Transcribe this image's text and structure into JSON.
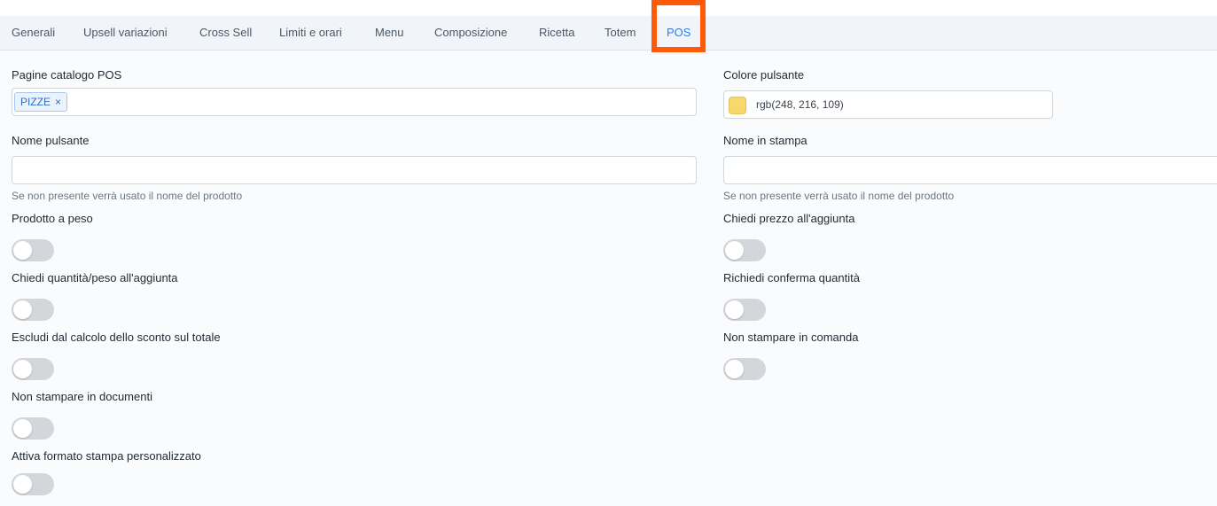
{
  "tabs": [
    {
      "label": "Generali",
      "active": false
    },
    {
      "label": "Upsell variazioni",
      "active": false
    },
    {
      "label": "Cross Sell",
      "active": false
    },
    {
      "label": "Limiti e orari",
      "active": false
    },
    {
      "label": "Menu",
      "active": false
    },
    {
      "label": "Composizione",
      "active": false
    },
    {
      "label": "Ricetta",
      "active": false
    },
    {
      "label": "Totem",
      "active": false
    },
    {
      "label": "POS",
      "active": true
    }
  ],
  "form": {
    "catalog_pages": {
      "label": "Pagine catalogo POS",
      "chips": [
        {
          "label": "PIZZE",
          "remove": "×"
        }
      ]
    },
    "button_color": {
      "label": "Colore pulsante",
      "value": "rgb(248, 216, 109)",
      "swatch": "#f8d86d"
    },
    "button_name": {
      "label": "Nome pulsante",
      "value": "",
      "placeholder": "",
      "hint": "Se non presente verrà usato il nome del prodotto"
    },
    "print_name": {
      "label": "Nome in stampa",
      "value": "",
      "placeholder": "",
      "hint": "Se non presente verrà usato il nome del prodotto"
    },
    "toggles": {
      "weighted_product": {
        "label": "Prodotto a peso",
        "on": false
      },
      "ask_price": {
        "label": "Chiedi prezzo all'aggiunta",
        "on": false
      },
      "ask_quantity": {
        "label": "Chiedi quantità/peso all'aggiunta",
        "on": false
      },
      "confirm_quantity": {
        "label": "Richiedi conferma quantità",
        "on": false
      },
      "exclude_discount": {
        "label": "Escludi dal calcolo dello sconto sul totale",
        "on": false
      },
      "no_print_order": {
        "label": "Non stampare in comanda",
        "on": false
      },
      "no_print_documents": {
        "label": "Non stampare in documenti",
        "on": false
      },
      "custom_print_format": {
        "label": "Attiva formato stampa personalizzato",
        "on": false
      }
    }
  },
  "colors": {
    "accent": "#2f7ee6",
    "highlight": "#ff5a0a",
    "toggle_off": "#d3d7dc"
  }
}
